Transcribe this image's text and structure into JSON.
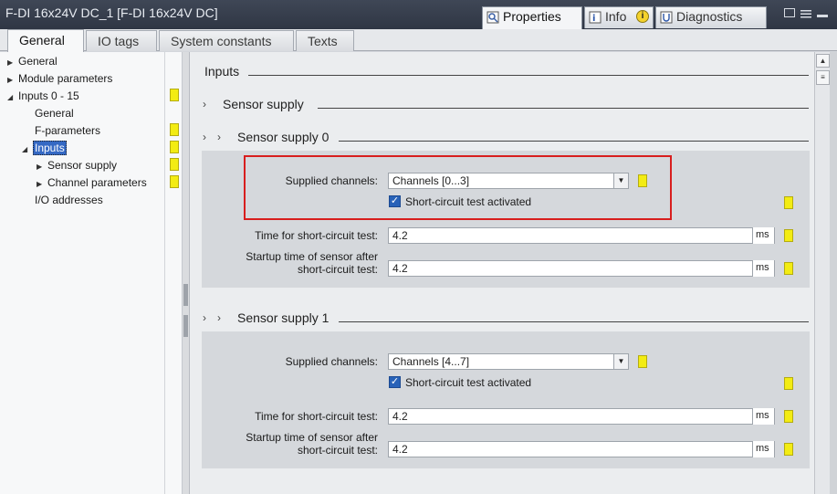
{
  "window": {
    "title": "F-DI 16x24V DC_1 [F-DI 16x24V DC]",
    "tabs": [
      {
        "label": "Properties",
        "icon": "properties-icon"
      },
      {
        "label": "Info",
        "icon": "info-icon",
        "badge": "i"
      },
      {
        "label": "Diagnostics",
        "icon": "diagnostics-icon"
      }
    ]
  },
  "main_tabs": [
    "General",
    "IO tags",
    "System constants",
    "Texts"
  ],
  "tree": {
    "items": [
      {
        "label": "General",
        "arrow": "▶"
      },
      {
        "label": "Module parameters",
        "arrow": "▶"
      },
      {
        "label": "Inputs 0 - 15",
        "arrow": "◢"
      },
      {
        "label": "General",
        "arrow": ""
      },
      {
        "label": "F-parameters",
        "arrow": ""
      },
      {
        "label": "Inputs",
        "arrow": "◢"
      },
      {
        "label": "Sensor supply",
        "arrow": "▶"
      },
      {
        "label": "Channel parameters",
        "arrow": "▶"
      },
      {
        "label": "I/O addresses",
        "arrow": ""
      }
    ]
  },
  "content": {
    "header": "Inputs",
    "sensor_supply": "Sensor supply",
    "sensor_supply_0": {
      "title": "Sensor supply 0",
      "supplied_label": "Supplied channels:",
      "supplied_value": "Channels [0...3]",
      "check_label": "Short-circuit test activated",
      "time_label": "Time for short-circuit test:",
      "time_value": "4.2",
      "time_unit": "ms",
      "startup_label_1": "Startup time of sensor after",
      "startup_label_2": "short-circuit test:",
      "startup_value": "4.2",
      "startup_unit": "ms"
    },
    "sensor_supply_1": {
      "title": "Sensor supply 1",
      "supplied_label": "Supplied channels:",
      "supplied_value": "Channels [4...7]",
      "check_label": "Short-circuit test activated",
      "time_label": "Time for short-circuit test:",
      "time_value": "4.2",
      "time_unit": "ms",
      "startup_label_1": "Startup time of sensor after",
      "startup_label_2": "short-circuit test:",
      "startup_value": "4.2",
      "startup_unit": "ms"
    }
  },
  "colors": {
    "selection": "#3569c4",
    "marker": "#f3ec13",
    "highlight_box": "#d81e1e",
    "checkbox": "#2862b8"
  }
}
